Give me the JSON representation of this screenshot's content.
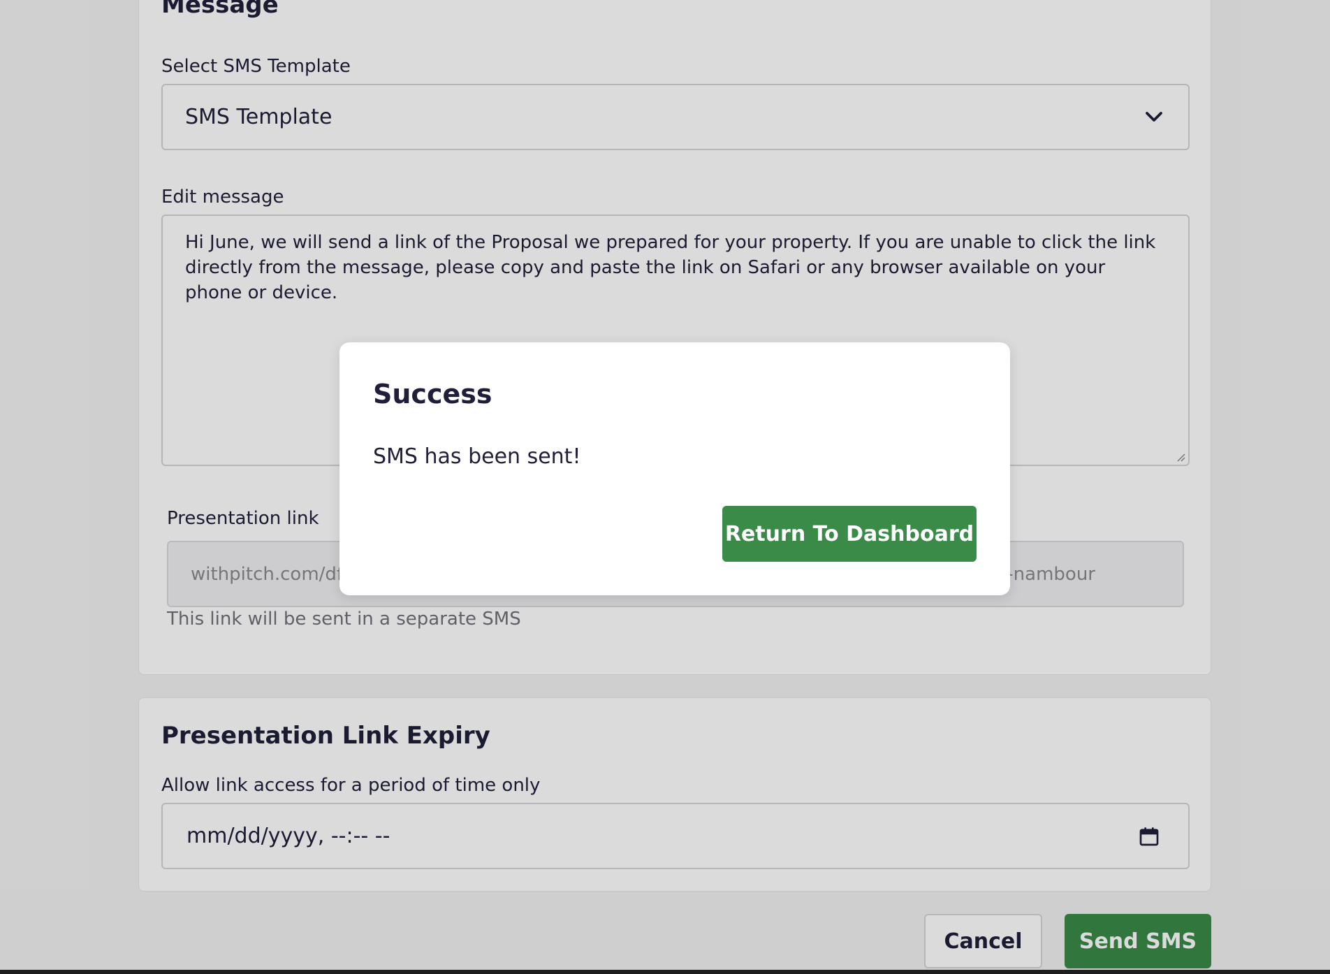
{
  "message_section": {
    "title": "Message",
    "template_label": "Select SMS Template",
    "template_value": "SMS Template",
    "edit_label": "Edit message",
    "message_text": "Hi June, we will send a link of the Proposal we prepared for your property. If you are unable to click the link directly from the message, please copy and paste the link on Safari or any browser available on your phone or device.",
    "link_label": "Presentation link",
    "link_value_left": "withpitch.com/df",
    "link_value_right": "-nambour",
    "link_help": "This link will be sent in a separate SMS"
  },
  "expiry_section": {
    "title": "Presentation Link Expiry",
    "label": "Allow link access for a period of time only",
    "datetime_placeholder": "mm/dd/yyyy, --:-- --"
  },
  "actions": {
    "cancel_label": "Cancel",
    "send_label": "Send SMS"
  },
  "modal": {
    "title": "Success",
    "message": "SMS has been sent!",
    "button_label": "Return To Dashboard"
  },
  "colors": {
    "primary_green": "#3a8a48",
    "text_dark": "#1f1f3a"
  },
  "icons": {
    "select": "chevron-down-icon",
    "date": "calendar-icon"
  }
}
